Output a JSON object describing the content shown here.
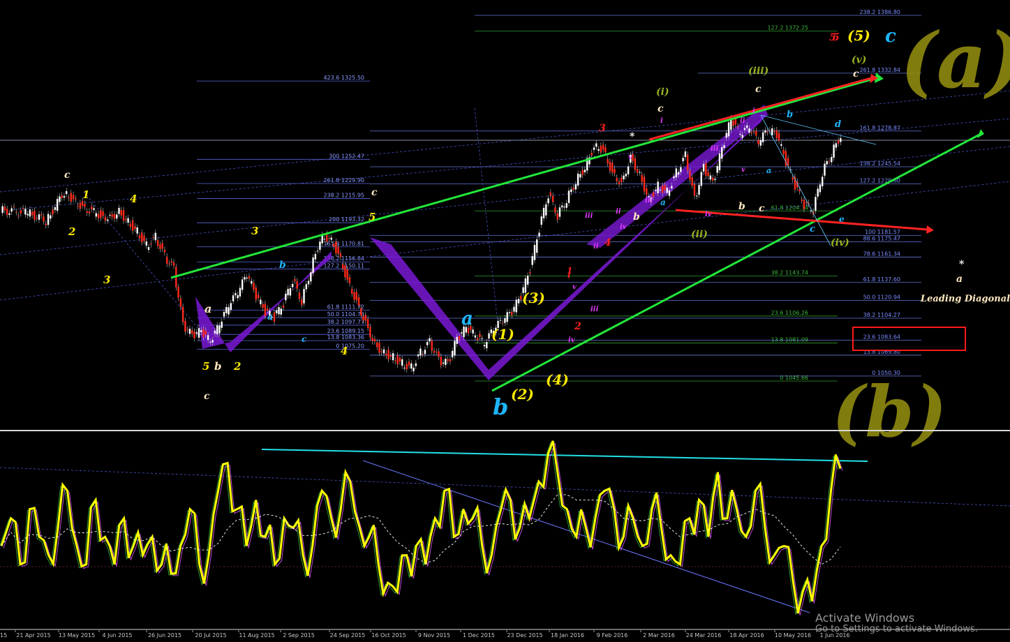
{
  "chart_data": [
    {
      "type": "candlestick",
      "instrument_panel": "price",
      "x_tick_labels": [
        "21 Apr 2015",
        "13 May 2015",
        "4 Jun 2015",
        "26 Jun 2015",
        "20 Jul 2015",
        "11 Aug 2015",
        "2 Sep 2015",
        "24 Sep 2015",
        "16 Oct 2015",
        "9 Nov 2015",
        "1 Dec 2015",
        "23 Dec 2015",
        "18 Jan 2016",
        "9 Feb 2016",
        "2 Mar 2016",
        "24 Mar 2016",
        "18 Apr 2016",
        "10 May 2016",
        "1 Jun 2016"
      ],
      "x_tick_prefix": "15",
      "price_path": [
        [
          0,
          1205
        ],
        [
          3,
          1203
        ],
        [
          5,
          1195
        ],
        [
          7,
          1222
        ],
        [
          8,
          1215
        ],
        [
          9,
          1208
        ],
        [
          11,
          1200
        ],
        [
          12,
          1198
        ],
        [
          13,
          1204
        ],
        [
          14,
          1194
        ],
        [
          15,
          1185
        ],
        [
          16,
          1172
        ],
        [
          17,
          1180
        ],
        [
          18,
          1162
        ],
        [
          19,
          1150
        ],
        [
          20,
          1098
        ],
        [
          21,
          1088
        ],
        [
          22,
          1092
        ],
        [
          23,
          1082
        ],
        [
          24,
          1098
        ],
        [
          25,
          1116
        ],
        [
          26,
          1128
        ],
        [
          27,
          1145
        ],
        [
          28,
          1125
        ],
        [
          29,
          1110
        ],
        [
          30,
          1105
        ],
        [
          31,
          1118
        ],
        [
          32,
          1140
        ],
        [
          33,
          1120
        ],
        [
          34,
          1150
        ],
        [
          35,
          1178
        ],
        [
          36,
          1180
        ],
        [
          37,
          1165
        ],
        [
          38,
          1140
        ],
        [
          39,
          1120
        ],
        [
          40,
          1100
        ],
        [
          41,
          1080
        ],
        [
          42,
          1072
        ],
        [
          43,
          1068
        ],
        [
          44,
          1062
        ],
        [
          45,
          1058
        ],
        [
          46,
          1072
        ],
        [
          47,
          1082
        ],
        [
          48,
          1065
        ],
        [
          49,
          1062
        ],
        [
          50,
          1085
        ],
        [
          51,
          1095
        ],
        [
          52,
          1088
        ],
        [
          53,
          1080
        ],
        [
          54,
          1094
        ],
        [
          55,
          1102
        ],
        [
          56,
          1110
        ],
        [
          57,
          1125
        ],
        [
          58,
          1150
        ],
        [
          59,
          1188
        ],
        [
          60,
          1220
        ],
        [
          61,
          1200
        ],
        [
          62,
          1215
        ],
        [
          63,
          1232
        ],
        [
          64,
          1245
        ],
        [
          65,
          1265
        ],
        [
          66,
          1262
        ],
        [
          67,
          1240
        ],
        [
          68,
          1230
        ],
        [
          69,
          1255
        ],
        [
          70,
          1238
        ],
        [
          71,
          1215
        ],
        [
          72,
          1228
        ],
        [
          73,
          1222
        ],
        [
          74,
          1240
        ],
        [
          75,
          1256
        ],
        [
          76,
          1215
        ],
        [
          77,
          1245
        ],
        [
          78,
          1230
        ],
        [
          79,
          1262
        ],
        [
          80,
          1290
        ],
        [
          81,
          1276
        ],
        [
          82,
          1282
        ],
        [
          83,
          1268
        ],
        [
          84,
          1280
        ],
        [
          85,
          1275
        ],
        [
          86,
          1250
        ],
        [
          87,
          1228
        ],
        [
          88,
          1210
        ],
        [
          89,
          1205
        ],
        [
          90,
          1240
        ],
        [
          91,
          1258
        ],
        [
          92,
          1275
        ]
      ],
      "price_axis_levels": [
        1045.66,
        1050.3,
        1069.8,
        1075.2,
        1081.09,
        1083.36,
        1083.64,
        1089.15,
        1097.77,
        1104.27,
        1104.75,
        1106.26,
        1111.72,
        1120.94,
        1137.6,
        1143.74,
        1150.11,
        1156.84,
        1161.34,
        1170.81,
        1174.04,
        1175.47,
        1181.57,
        1193.32,
        1204.34,
        1215.95,
        1229.9,
        1245.54,
        1252.47,
        1278.87,
        1325.5,
        1332.84,
        1372.25,
        1386.8
      ],
      "fib_levels_right": [
        {
          "label": "238.2 1386.80",
          "color": "#7a8cff"
        },
        {
          "label": "127.2 1372.25",
          "color": "#3bb93b"
        },
        {
          "label": "261.8 1332.84",
          "color": "#7a8cff"
        },
        {
          "label": "161.8 1278.87",
          "color": "#7a8cff"
        },
        {
          "label": "138.2 1245.54",
          "color": "#7a8cff"
        },
        {
          "label": "127.2 1229.60",
          "color": "#7a8cff"
        },
        {
          "label": "61.8 1204.34",
          "color": "#3bb93b"
        },
        {
          "label": "100 1181.57",
          "color": "#7a8cff"
        },
        {
          "label": "88.6 1175.47",
          "color": "#7a8cff"
        },
        {
          "label": "78.6 1161.34",
          "color": "#7a8cff"
        },
        {
          "label": "38.2 1143.74",
          "color": "#3bb93b"
        },
        {
          "label": "61.8 1137.60",
          "color": "#7a8cff"
        },
        {
          "label": "50.0 1120.94",
          "color": "#7a8cff"
        },
        {
          "label": "23.6 1106.26",
          "color": "#3bb93b"
        },
        {
          "label": "38.2 1104.27",
          "color": "#7a8cff"
        },
        {
          "label": "13.8 1081.09",
          "color": "#3bb93b"
        },
        {
          "label": "23.6 1083.64",
          "color": "#7a8cff"
        },
        {
          "label": "13.8 1069.80",
          "color": "#7a8cff"
        },
        {
          "label": "0 1045.66",
          "color": "#3bb93b"
        },
        {
          "label": "0 1050.30",
          "color": "#7a8cff"
        }
      ],
      "fib_levels_left": [
        {
          "label": "423.6 1325.50"
        },
        {
          "label": "300 1252.47"
        },
        {
          "label": "261.8 1229.90"
        },
        {
          "label": "238.2 1215.95"
        },
        {
          "label": "200 1193.32"
        },
        {
          "label": "161.8 1170.81"
        },
        {
          "label": "138.2 1156.84"
        },
        {
          "label": "127.2 1150.11"
        },
        {
          "label": "61.8 1111.72"
        },
        {
          "label": "50.0 1104.75"
        },
        {
          "label": "38.2 1097.77"
        },
        {
          "label": "23.6 1089.15"
        },
        {
          "label": "13.8 1083.36"
        },
        {
          "label": "0 1075.20"
        }
      ],
      "annotations": [
        "Leading Diagonal"
      ],
      "hand_drawn_labels": [
        "(a)",
        "(b)"
      ],
      "wave_labels": {
        "white": [
          "c",
          "c",
          "c",
          "c",
          "c",
          "*",
          "*",
          "a",
          "b",
          "b",
          "c"
        ],
        "yellow": [
          "1",
          "2",
          "3",
          "4",
          "5",
          "3",
          "4",
          "5",
          "2",
          "5",
          "(1)",
          "(2)",
          "(3)",
          "(4)",
          "(5)",
          "a",
          "b",
          "c"
        ],
        "blue": [
          "a",
          "b",
          "b",
          "c",
          "a",
          "c",
          "d",
          "e",
          "c",
          "b",
          "a",
          "a"
        ],
        "olive": [
          "(i)",
          "(ii)",
          "(iii)",
          "(iv)",
          "(v)"
        ],
        "red": [
          "3",
          "4",
          "2",
          "i",
          "5",
          "1"
        ],
        "magenta": [
          "iii",
          "iv",
          "v",
          "i",
          "ii",
          "iii",
          "iv",
          "v",
          "i",
          "ii",
          "iii",
          "iv",
          "v",
          "ii",
          "iii"
        ]
      }
    },
    {
      "type": "line",
      "instrument_panel": "oscillator",
      "series": [
        {
          "color": "#ffff00",
          "values": [
            40,
            55,
            30,
            60,
            45,
            35,
            50,
            70,
            40,
            30,
            65,
            45,
            30,
            55,
            40,
            35,
            45,
            30,
            25,
            40,
            60,
            30,
            35,
            70,
            85,
            60,
            40,
            65,
            45,
            30,
            55,
            50,
            35,
            40,
            70,
            55,
            60,
            75,
            50,
            45,
            30,
            20,
            15,
            35,
            40,
            30,
            55,
            70,
            45,
            60,
            55,
            40,
            35,
            60,
            65,
            50,
            55,
            75,
            90,
            80,
            60,
            45,
            50,
            55,
            70,
            60,
            45,
            55,
            40,
            60,
            50,
            35,
            30,
            55,
            65,
            45,
            80,
            55,
            60,
            45,
            70,
            50,
            35,
            40,
            20,
            15,
            10,
            40,
            70,
            82
          ]
        },
        {
          "color": "#2f9e2f",
          "values": []
        },
        {
          "color": "#c04ad6",
          "values": []
        }
      ]
    }
  ]
}
